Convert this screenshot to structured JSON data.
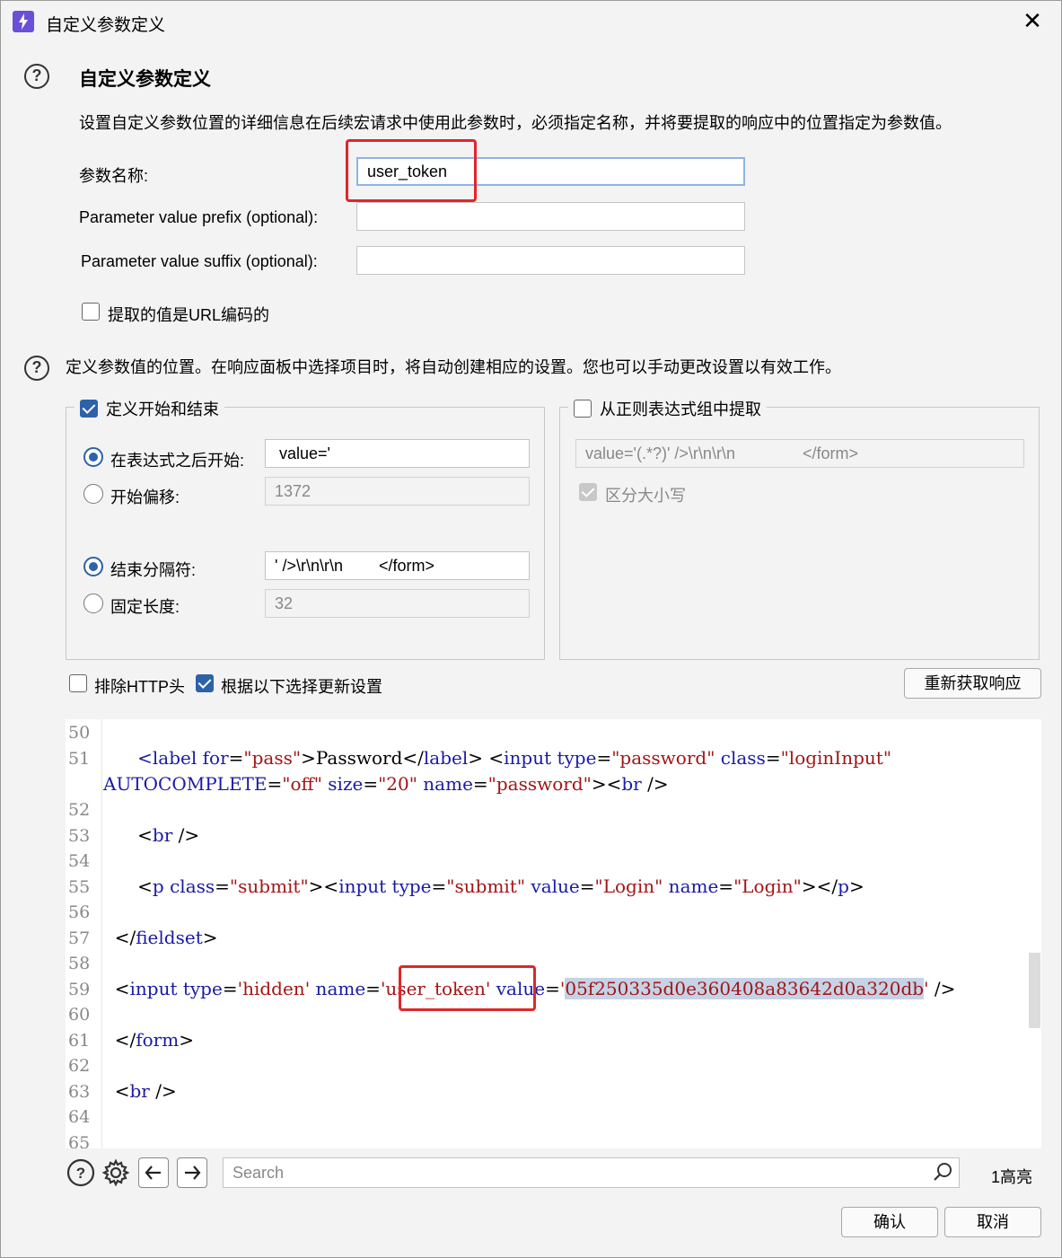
{
  "window": {
    "title": "自定义参数定义",
    "close_glyph": "✕"
  },
  "header": {
    "heading": "自定义参数定义",
    "description": "设置自定义参数位置的详细信息在后续宏请求中使用此参数时，必须指定名称，并将要提取的响应中的位置指定为参数值。"
  },
  "form": {
    "name_label": "参数名称:",
    "name_value": "user_token",
    "prefix_label": "Parameter value prefix (optional):",
    "prefix_value": "",
    "suffix_label": "Parameter value suffix (optional):",
    "suffix_value": "",
    "url_encoded_label": "提取的值是URL编码的",
    "url_encoded_checked": false
  },
  "location": {
    "description": "定义参数值的位置。在响应面板中选择项目时，将自动创建相应的设置。您也可以手动更改设置以有效工作。",
    "start_end_group": {
      "label": "定义开始和结束",
      "checked": true,
      "start_after_label": "在表达式之后开始:",
      "start_after_value": " value='",
      "start_offset_label": "开始偏移:",
      "start_offset_value": "1372",
      "end_delim_label": "结束分隔符:",
      "end_delim_value": "' />\\r\\n\\r\\n        </form>",
      "fixed_length_label": "固定长度:",
      "fixed_length_value": "32"
    },
    "regex_group": {
      "label": "从正则表达式组中提取",
      "checked": false,
      "regex_value": "value='(.*?)' />\\r\\n\\r\\n               </form>",
      "case_sensitive_label": "区分大小写"
    },
    "exclude_http_label": "排除HTTP头",
    "update_config_label": "根据以下选择更新设置",
    "refetch_button": "重新获取响应"
  },
  "editor": {
    "line_numbers": [
      "50",
      "51",
      "",
      "52",
      "53",
      "54",
      "55",
      "56",
      "57",
      "58",
      "59",
      "60",
      "61",
      "62",
      "63",
      "64",
      "65"
    ],
    "line51a": {
      "indent": "      ",
      "t1": "<label ",
      "a1": "for",
      "eq1": "=",
      "v1": "\"pass\"",
      "t2": ">Password</",
      "t3": "label",
      "t4": "> <",
      "t5": "input ",
      "a2": "type",
      "eq2": "=",
      "v2": "\"password\"",
      "sp": " ",
      "a3": "class",
      "eq3": "=",
      "v3": "\"loginInput\""
    },
    "line51b": {
      "a1": "AUTOCOMPLETE",
      "eq1": "=",
      "v1": "\"off\"",
      "a2": " size",
      "eq2": "=",
      "v2": "\"20\"",
      "a3": " name",
      "eq3": "=",
      "v3": "\"password\"",
      "t1": "><",
      "t2": "br",
      "t3": " />"
    },
    "line53": {
      "indent": "      ",
      "t1": "<",
      "t2": "br",
      "t3": " />"
    },
    "line55": {
      "indent": "      ",
      "t1": "<",
      "t2": "p ",
      "a1": "class",
      "eq1": "=",
      "v1": "\"submit\"",
      "t3": "><",
      "t4": "input ",
      "a2": "type",
      "eq2": "=",
      "v2": "\"submit\"",
      "a3": " value",
      "eq3": "=",
      "v3": "\"Login\"",
      "a4": " name",
      "eq4": "=",
      "v4": "\"Login\"",
      "t5": "></",
      "t6": "p",
      "t7": ">"
    },
    "line57": {
      "indent": "  ",
      "t1": "</",
      "t2": "fieldset",
      "t3": ">"
    },
    "line59": {
      "indent": "  ",
      "t1": "<",
      "t2": "input ",
      "a1": "type",
      "eq1": "=",
      "v1": "'hidden'",
      "a2": " name",
      "eq2": "=",
      "v2": "'user_token'",
      "a3": " value",
      "eq3": "=",
      "q1": "'",
      "hl": "05f250335d0e360408a83642d0a320db",
      "q2": "'",
      "t3": " />"
    },
    "line61": {
      "indent": "  ",
      "t1": "</",
      "t2": "form",
      "t3": ">"
    },
    "line63": {
      "indent": "  ",
      "t1": "<",
      "t2": "br",
      "t3": " />"
    }
  },
  "search": {
    "placeholder": "Search",
    "highlight_count": "1高亮"
  },
  "footer": {
    "ok": "确认",
    "cancel": "取消"
  },
  "colors": {
    "accent": "#2d62a8",
    "annotation": "#e0262b",
    "tag": "#1a1aa6",
    "value": "#a31515"
  }
}
